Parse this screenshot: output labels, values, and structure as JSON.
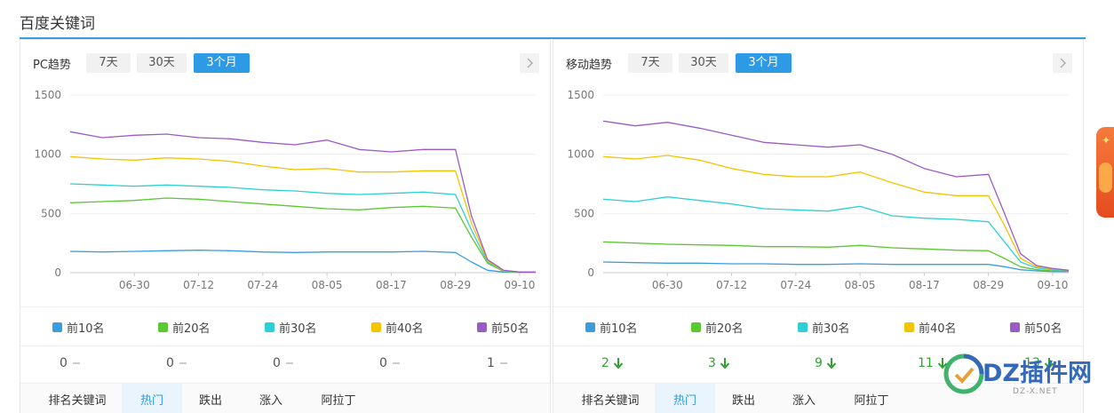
{
  "page": {
    "title": "百度关键词"
  },
  "range_options": [
    "7天",
    "30天",
    "3个月"
  ],
  "legend": [
    {
      "label": "前10名",
      "color": "#3a9de0"
    },
    {
      "label": "前20名",
      "color": "#5ac832"
    },
    {
      "label": "前30名",
      "color": "#2dd0d6"
    },
    {
      "label": "前40名",
      "color": "#f5c400"
    },
    {
      "label": "前50名",
      "color": "#9b5ac8"
    }
  ],
  "tabs": [
    "排名关键词",
    "热门",
    "跌出",
    "涨入",
    "阿拉丁"
  ],
  "panels": [
    {
      "title": "PC趋势",
      "active_range": 2,
      "counts": [
        {
          "value": "0",
          "trend": "flat"
        },
        {
          "value": "0",
          "trend": "flat"
        },
        {
          "value": "0",
          "trend": "flat"
        },
        {
          "value": "0",
          "trend": "flat"
        },
        {
          "value": "1",
          "trend": "flat"
        }
      ]
    },
    {
      "title": "移动趋势",
      "active_range": 2,
      "counts": [
        {
          "value": "2",
          "trend": "down"
        },
        {
          "value": "3",
          "trend": "down"
        },
        {
          "value": "9",
          "trend": "down"
        },
        {
          "value": "11",
          "trend": "down"
        },
        {
          "value": "13",
          "trend": "down"
        }
      ]
    }
  ],
  "watermark": {
    "brand": "DZ插件网",
    "url": "DZ-X.NET"
  },
  "chart_data": [
    {
      "type": "line",
      "title": "PC趋势",
      "xticks": [
        "06-30",
        "07-12",
        "07-24",
        "08-05",
        "08-17",
        "08-29",
        "09-10"
      ],
      "yticks": [
        0,
        500,
        1000,
        1500
      ],
      "ylim": [
        0,
        1500
      ],
      "grid": true,
      "legend": "bottom",
      "x": [
        "06-18",
        "06-24",
        "06-30",
        "07-06",
        "07-12",
        "07-18",
        "07-24",
        "07-30",
        "08-05",
        "08-11",
        "08-17",
        "08-23",
        "08-29",
        "09-01",
        "09-04",
        "09-07",
        "09-10",
        "09-13"
      ],
      "series": [
        {
          "name": "前10名",
          "values": [
            180,
            175,
            180,
            185,
            190,
            185,
            175,
            170,
            175,
            175,
            175,
            180,
            170,
            90,
            20,
            5,
            3,
            3
          ]
        },
        {
          "name": "前20名",
          "values": [
            590,
            600,
            610,
            630,
            620,
            600,
            580,
            560,
            540,
            530,
            550,
            560,
            545,
            300,
            80,
            10,
            5,
            5
          ]
        },
        {
          "name": "前30名",
          "values": [
            750,
            740,
            730,
            740,
            730,
            720,
            700,
            690,
            670,
            660,
            670,
            680,
            660,
            360,
            90,
            15,
            5,
            5
          ]
        },
        {
          "name": "前40名",
          "values": [
            980,
            960,
            950,
            970,
            960,
            940,
            900,
            870,
            880,
            850,
            850,
            860,
            860,
            420,
            100,
            15,
            5,
            5
          ]
        },
        {
          "name": "前50名",
          "values": [
            1190,
            1140,
            1160,
            1170,
            1140,
            1130,
            1100,
            1080,
            1120,
            1040,
            1020,
            1040,
            1040,
            480,
            110,
            20,
            5,
            5
          ]
        }
      ]
    },
    {
      "type": "line",
      "title": "移动趋势",
      "xticks": [
        "06-30",
        "07-12",
        "07-24",
        "08-05",
        "08-17",
        "08-29",
        "09-10"
      ],
      "yticks": [
        0,
        500,
        1000,
        1500
      ],
      "ylim": [
        0,
        1500
      ],
      "grid": true,
      "legend": "bottom",
      "x": [
        "06-18",
        "06-24",
        "06-30",
        "07-06",
        "07-12",
        "07-18",
        "07-24",
        "07-30",
        "08-05",
        "08-11",
        "08-17",
        "08-23",
        "08-29",
        "09-01",
        "09-04",
        "09-07",
        "09-10",
        "09-13"
      ],
      "series": [
        {
          "name": "前10名",
          "values": [
            90,
            85,
            80,
            80,
            75,
            75,
            70,
            70,
            75,
            70,
            70,
            70,
            70,
            50,
            25,
            15,
            10,
            8
          ]
        },
        {
          "name": "前20名",
          "values": [
            260,
            250,
            240,
            235,
            230,
            220,
            220,
            215,
            230,
            210,
            200,
            190,
            185,
            120,
            50,
            25,
            15,
            10
          ]
        },
        {
          "name": "前30名",
          "values": [
            620,
            600,
            640,
            610,
            580,
            540,
            530,
            520,
            560,
            480,
            460,
            450,
            430,
            260,
            90,
            40,
            25,
            15
          ]
        },
        {
          "name": "前40名",
          "values": [
            980,
            960,
            990,
            950,
            880,
            830,
            810,
            810,
            850,
            760,
            680,
            650,
            650,
            400,
            120,
            50,
            30,
            20
          ]
        },
        {
          "name": "前50名",
          "values": [
            1280,
            1240,
            1270,
            1220,
            1160,
            1100,
            1080,
            1060,
            1080,
            1000,
            880,
            810,
            830,
            500,
            160,
            60,
            35,
            20
          ]
        }
      ]
    }
  ]
}
